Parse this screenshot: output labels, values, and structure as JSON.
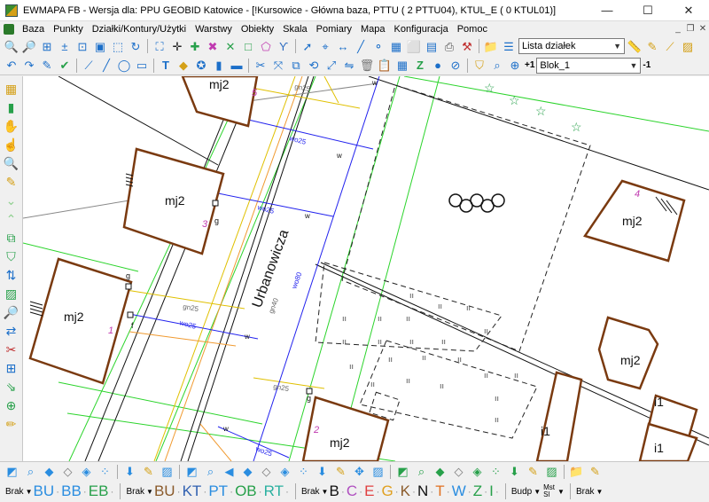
{
  "window": {
    "title": "EWMAPA FB - Wersja dla: PPU GEOBID Katowice - [!Kursowice - Główna baza, PTTU ( 2 PTTU04), KTUL_E ( 0 KTUL01)]",
    "minimize": "—",
    "maximize": "☐",
    "close": "✕"
  },
  "menu": {
    "items": [
      "Baza",
      "Punkty",
      "Działki/Kontury/Użytki",
      "Warstwy",
      "Obiekty",
      "Skala",
      "Pomiary",
      "Mapa",
      "Konfiguracja",
      "Pomoc"
    ],
    "mdi_min": "_",
    "mdi_restore": "❐",
    "mdi_close": "✕"
  },
  "toolbar": {
    "parcel_list": "Lista działek",
    "block_prefix": "+1",
    "block_value": "Blok_1",
    "block_suffix": "-1"
  },
  "map": {
    "street_name": "Urbanowicza",
    "building_label": "mj2",
    "commercial_label": "i1",
    "line_labels": [
      "wo25",
      "wo25",
      "wo25",
      "wo25",
      "wo25",
      "wo80",
      "gn25",
      "gn25",
      "gn25",
      "gn25",
      "gn40",
      "w",
      "w",
      "w",
      "w",
      "w"
    ],
    "point_labels": [
      "g",
      "g",
      "g",
      "g",
      "f",
      "f"
    ],
    "building_numbers": [
      "5",
      "3",
      "1",
      "2",
      "4"
    ]
  },
  "codebar": {
    "groups": [
      {
        "brak": "Brak",
        "codes": [
          {
            "t": "BU",
            "c": "#2a8de0"
          },
          {
            "t": "BB",
            "c": "#2a8de0"
          },
          {
            "t": "EB",
            "c": "#27a04a"
          }
        ]
      },
      {
        "brak": "Brak",
        "codes": [
          {
            "t": "BU",
            "c": "#8a5a2a"
          },
          {
            "t": "KT",
            "c": "#3060b0"
          },
          {
            "t": "PT",
            "c": "#2a8de0"
          },
          {
            "t": "OB",
            "c": "#27a04a"
          },
          {
            "t": "RT",
            "c": "#2ab0a0"
          }
        ]
      },
      {
        "brak": "Brak",
        "codes": [
          {
            "t": "B",
            "c": "#111111"
          },
          {
            "t": "C",
            "c": "#b050c0"
          },
          {
            "t": "E",
            "c": "#e04040"
          },
          {
            "t": "G",
            "c": "#e0a020"
          },
          {
            "t": "K",
            "c": "#8a5a2a"
          },
          {
            "t": "N",
            "c": "#111111"
          },
          {
            "t": "T",
            "c": "#e07020"
          },
          {
            "t": "W",
            "c": "#2a8de0"
          },
          {
            "t": "Z",
            "c": "#27a04a"
          },
          {
            "t": "I",
            "c": "#27a04a"
          }
        ]
      },
      {
        "brak": "Budp",
        "codes": []
      },
      {
        "brak": "Brak",
        "codes": []
      }
    ],
    "mst_top": "Mst",
    "mst_bottom": "Sl"
  }
}
